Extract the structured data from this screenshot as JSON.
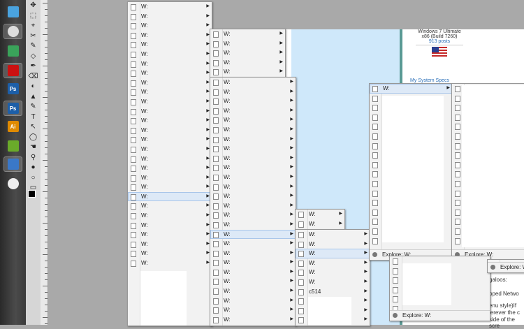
{
  "drive_label": "W:",
  "explore_label": "Explore: W:",
  "folder_label": "c514",
  "forum": {
    "os_line1": "Windows 7 Ultimate",
    "os_line2": "x86 (Build 7260)",
    "posts": "913 posts",
    "specs_link": "My System Specs",
    "fragment1": "galoos:",
    "fragment2": "pped Netwo",
    "fragment3": "enu style)If",
    "fragment4": "ierever the c",
    "fragment5": "side of the scre"
  },
  "taskbar": {
    "items": [
      {
        "icon": "eraser-icon",
        "color": "#4aa3df"
      },
      {
        "icon": "skull-icon",
        "color": "#dddddd"
      },
      {
        "icon": "messenger-icon",
        "color": "#3aa35a"
      },
      {
        "icon": "opera-icon",
        "color": "#cc1111"
      },
      {
        "icon": "photoshop-icon",
        "text": "Ps",
        "color": "#1d5fa8"
      },
      {
        "icon": "photoshop-icon",
        "text": "Ps",
        "color": "#1d5fa8"
      },
      {
        "icon": "illustrator-icon",
        "text": "Ai",
        "color": "#e08a00"
      },
      {
        "icon": "evernote-icon",
        "color": "#6aaa2a"
      },
      {
        "icon": "remote-desktop-icon",
        "color": "#3a78c8"
      },
      {
        "icon": "disc-icon",
        "color": "#eeeeee"
      }
    ]
  }
}
